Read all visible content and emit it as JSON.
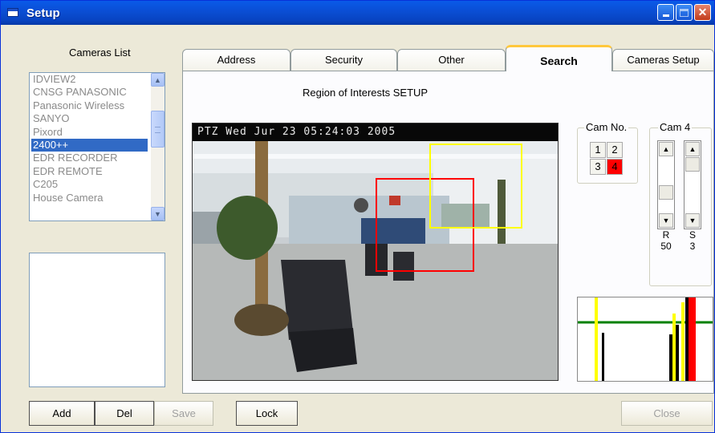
{
  "window": {
    "title": "Setup"
  },
  "cameras_list": {
    "title": "Cameras List",
    "items": [
      {
        "label": "IDVIEW2",
        "selected": false
      },
      {
        "label": "CNSG PANASONIC",
        "selected": false
      },
      {
        "label": "Panasonic Wireless",
        "selected": false
      },
      {
        "label": "SANYO",
        "selected": false
      },
      {
        "label": "Pixord",
        "selected": false
      },
      {
        "label": "2400++",
        "selected": true
      },
      {
        "label": "EDR RECORDER",
        "selected": false
      },
      {
        "label": "EDR REMOTE",
        "selected": false
      },
      {
        "label": "C205",
        "selected": false
      },
      {
        "label": "House Camera",
        "selected": false
      }
    ]
  },
  "tabs": [
    {
      "label": "Address"
    },
    {
      "label": "Security"
    },
    {
      "label": "Other"
    },
    {
      "label": "Search",
      "active": true
    },
    {
      "label": "Cameras Setup"
    }
  ],
  "search_panel": {
    "title": "Region of Interests SETUP",
    "video_osd": "PTZ  Wed Jur 23  05:24:03  2005",
    "cam_no": {
      "legend": "Cam No.",
      "buttons": [
        {
          "label": "1",
          "active": false
        },
        {
          "label": "2",
          "active": false
        },
        {
          "label": "3",
          "active": false
        },
        {
          "label": "4",
          "active": true
        }
      ]
    },
    "cam_settings": {
      "legend": "Cam 4",
      "sliders": [
        {
          "letter": "R",
          "value": "50"
        },
        {
          "letter": "S",
          "value": "3"
        }
      ]
    },
    "roi_colors": {
      "region_1": "#ff0000",
      "region_2": "#ffff00"
    }
  },
  "buttons": {
    "add": "Add",
    "del": "Del",
    "save": "Save",
    "lock": "Lock",
    "close": "Close"
  }
}
